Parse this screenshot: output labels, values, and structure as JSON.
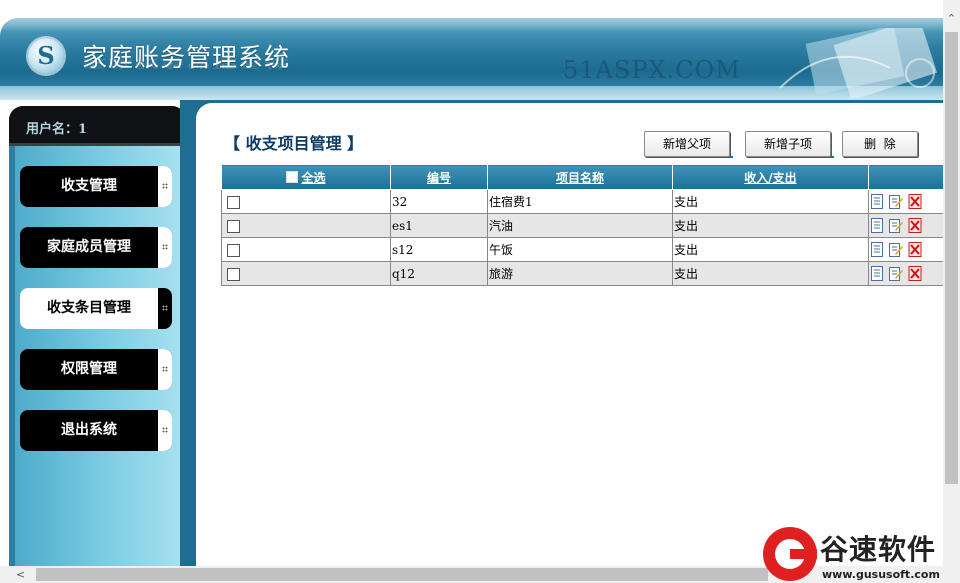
{
  "header": {
    "system_title": "家庭账务管理系统",
    "watermark": "51ASPX.COM"
  },
  "sidebar": {
    "user_label": "用户名：1",
    "items": [
      {
        "label": "收支管理",
        "active": false
      },
      {
        "label": "家庭成员管理",
        "active": false
      },
      {
        "label": "收支条目管理",
        "active": true
      },
      {
        "label": "权限管理",
        "active": false
      },
      {
        "label": "退出系统",
        "active": false
      }
    ]
  },
  "main": {
    "section_title": "【 收支项目管理 】",
    "buttons": {
      "add_parent": "新增父项",
      "add_child": "新增子项",
      "delete": "删  除"
    },
    "table": {
      "headers": [
        "全选",
        "编号",
        "项目名称",
        "收入/支出"
      ],
      "rows": [
        {
          "id": "32",
          "name": "住宿费1",
          "type": "支出"
        },
        {
          "id": "es1",
          "name": "汽油",
          "type": "支出"
        },
        {
          "id": "s12",
          "name": "午饭",
          "type": "支出"
        },
        {
          "id": "q12",
          "name": "旅游",
          "type": "支出"
        }
      ],
      "row_actions": [
        "view-icon",
        "edit-icon",
        "delete-icon"
      ]
    }
  },
  "brand": {
    "name": "谷速软件",
    "url": "www.gususoft.com"
  },
  "colors": {
    "header_blue": "#2e7fa3",
    "sidebar_cyan": "#7ccde3",
    "nav_black": "#000000",
    "table_header": "#1f6f95",
    "brand_red": "#e02020"
  }
}
